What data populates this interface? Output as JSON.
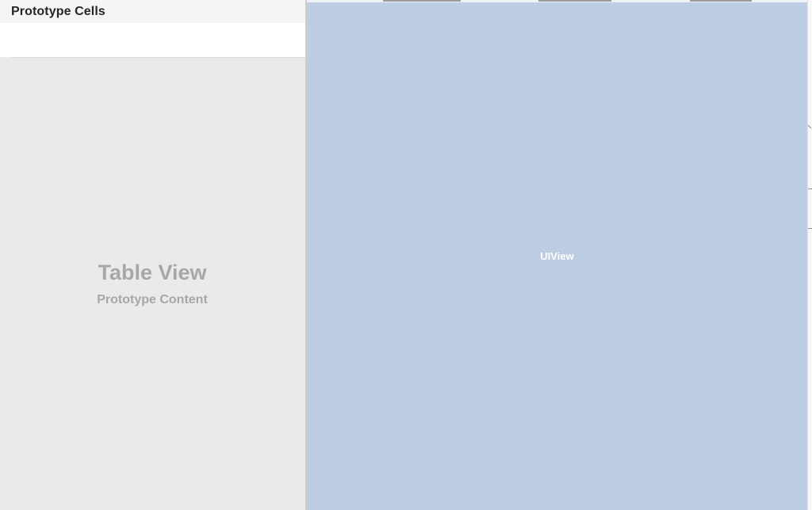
{
  "table_view": {
    "section_header": "Prototype Cells",
    "placeholder_title": "Table View",
    "placeholder_subtitle": "Prototype Content"
  },
  "ui_view": {
    "label": "UIView"
  },
  "colors": {
    "table_background": "#eaeaea",
    "view_background": "#bdcde3",
    "placeholder_text": "#a7a7a7",
    "header_text": "#262626"
  }
}
